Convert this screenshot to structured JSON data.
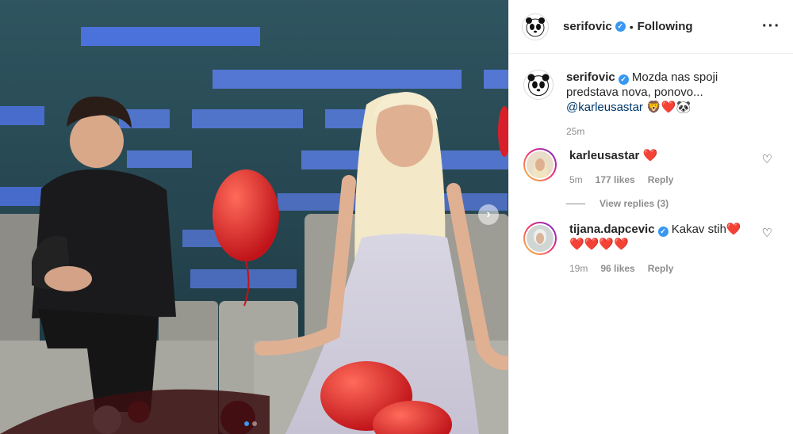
{
  "post": {
    "author": "serifovic",
    "follow_status": "Following",
    "separator": "•",
    "more_icon": "more-horizontal-icon",
    "caption": {
      "username": "serifovic",
      "text": "Mozda nas spoji predstava nova, ponovo...",
      "mention": "@karleusastar",
      "emoji": "🦁❤️🐼",
      "time": "25m"
    },
    "carousel": {
      "count": 2,
      "active": 1
    }
  },
  "comments": [
    {
      "username": "karleusastar",
      "verified": false,
      "text": "❤️",
      "time": "5m",
      "likes": "177 likes",
      "reply": "Reply",
      "view_replies": "View replies (3)"
    },
    {
      "username": "tijana.dapcevic",
      "verified": true,
      "text": "Kakav stih❤️",
      "text2": "❤️❤️❤️❤️",
      "time": "19m",
      "likes": "96 likes",
      "reply": "Reply"
    }
  ],
  "colors": {
    "link": "#00376b",
    "verified": "#3897f0",
    "muted": "#8e8e8e",
    "heart": "#ed4956"
  }
}
